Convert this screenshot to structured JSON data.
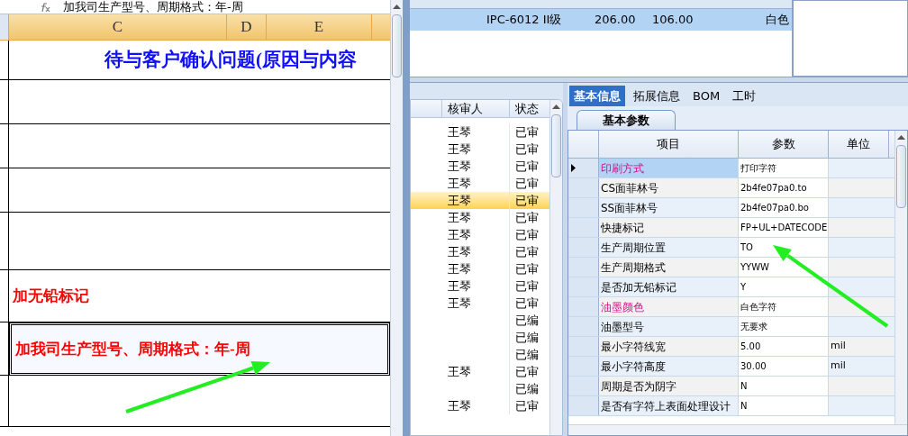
{
  "sheet": {
    "formula_bar": "加我司生产型号、周期格式：年-周",
    "columns": [
      "C",
      "D",
      "E"
    ],
    "rows": [
      {
        "kind": "heading",
        "text": "待与客户确认问题(原因与内容"
      },
      {
        "kind": "blank"
      },
      {
        "kind": "blank"
      },
      {
        "kind": "blank"
      },
      {
        "kind": "blank"
      },
      {
        "kind": "note",
        "text": "加无铅标记",
        "selected": false
      },
      {
        "kind": "note",
        "text": "加我司生产型号、周期格式：年-周",
        "selected": true
      },
      {
        "kind": "blank"
      }
    ]
  },
  "top_grid": {
    "rows": [
      {
        "selected": true,
        "cells": [
          "IPC-6012 II级",
          "206.00",
          "106.00",
          "白色"
        ]
      }
    ]
  },
  "review_list": {
    "columns": [
      "核审人",
      "状态"
    ],
    "rows": [
      {
        "reviewer": "王琴",
        "status": "已审",
        "selected": false
      },
      {
        "reviewer": "王琴",
        "status": "已审",
        "selected": false
      },
      {
        "reviewer": "王琴",
        "status": "已审",
        "selected": false
      },
      {
        "reviewer": "王琴",
        "status": "已审",
        "selected": false
      },
      {
        "reviewer": "王琴",
        "status": "已审",
        "selected": true
      },
      {
        "reviewer": "王琴",
        "status": "已审",
        "selected": false
      },
      {
        "reviewer": "王琴",
        "status": "已审",
        "selected": false
      },
      {
        "reviewer": "王琴",
        "status": "已审",
        "selected": false
      },
      {
        "reviewer": "王琴",
        "status": "已审",
        "selected": false
      },
      {
        "reviewer": "王琴",
        "status": "已审",
        "selected": false
      },
      {
        "reviewer": "王琴",
        "status": "已审",
        "selected": false
      },
      {
        "status": "已编",
        "selected": false
      },
      {
        "status": "已编",
        "selected": false
      },
      {
        "status": "已编",
        "selected": false
      },
      {
        "reviewer": "王琴",
        "status": "已审",
        "selected": false
      },
      {
        "status": "已编",
        "selected": false
      },
      {
        "reviewer": "王琴",
        "status": "已审",
        "selected": false
      }
    ]
  },
  "detail": {
    "tabs": [
      {
        "label": "基本信息",
        "selected": true
      },
      {
        "label": "拓展信息",
        "selected": false
      },
      {
        "label": "BOM",
        "selected": false
      },
      {
        "label": "工时",
        "selected": false
      }
    ],
    "subtab": "基本参数",
    "columns": [
      "项目",
      "参数",
      "单位"
    ],
    "rows": [
      {
        "item": "印刷方式",
        "value": "打印字符",
        "highlighted": true,
        "selected": true
      },
      {
        "item": "CS面菲林号",
        "value": "2b4fe07pa0.to",
        "highlighted": false,
        "selected": false
      },
      {
        "item": "SS面菲林号",
        "value": "2b4fe07pa0.bo",
        "highlighted": false,
        "selected": false
      },
      {
        "item": "快捷标记",
        "value": "FP+UL+DATECODE",
        "highlighted": false,
        "selected": false
      },
      {
        "item": "生产周期位置",
        "value": "TO",
        "highlighted": false,
        "selected": false
      },
      {
        "item": "生产周期格式",
        "value": "YYWW",
        "highlighted": false,
        "selected": false
      },
      {
        "item": "是否加无铅标记",
        "value": "Y",
        "highlighted": false,
        "selected": false
      },
      {
        "item": "油墨颜色",
        "value": "白色字符",
        "highlighted": true,
        "selected": false
      },
      {
        "item": "油墨型号",
        "value": "无要求",
        "highlighted": false,
        "selected": false
      },
      {
        "item": "最小字符线宽",
        "value": "5.00",
        "unit": "mil",
        "highlighted": false,
        "selected": false
      },
      {
        "item": "最小字符高度",
        "value": "30.00",
        "unit": "mil",
        "highlighted": false,
        "selected": false
      },
      {
        "item": "周期是否为阴字",
        "value": "N",
        "highlighted": false,
        "selected": false
      },
      {
        "item": "是否有字符上表面处理设计",
        "value": "N",
        "highlighted": false,
        "selected": false
      }
    ]
  }
}
